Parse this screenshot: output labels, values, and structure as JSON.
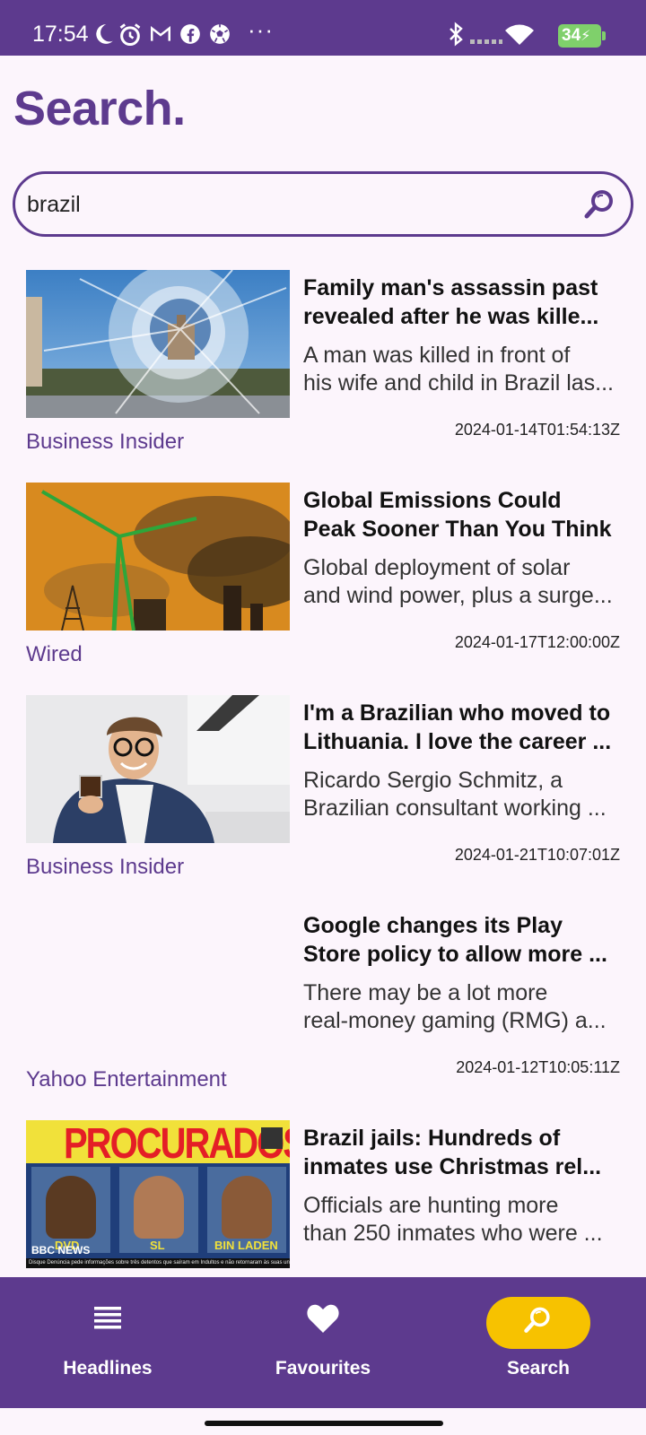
{
  "status_bar": {
    "time": "17:54",
    "battery": "34",
    "icons": [
      "moon-icon",
      "alarm-icon",
      "gmail-icon",
      "facebook-icon",
      "football-icon",
      "more-icon",
      "bluetooth-icon",
      "signal-icon",
      "wifi-icon",
      "battery-icon"
    ]
  },
  "page": {
    "title": "Search."
  },
  "search": {
    "value": "brazil",
    "icon": "search-icon"
  },
  "articles": [
    {
      "headline_lines": [
        "Family man's assassin past",
        "revealed after he was kille..."
      ],
      "description_lines": [
        "A man was killed in front of",
        "his wife and child in Brazil las..."
      ],
      "date": "2024-01-14T01:54:13Z",
      "source": "Business Insider"
    },
    {
      "headline_lines": [
        "Global Emissions Could",
        "Peak Sooner Than You Think"
      ],
      "description_lines": [
        "Global deployment of solar",
        "and wind power, plus a surge..."
      ],
      "date": "2024-01-17T12:00:00Z",
      "source": "Wired"
    },
    {
      "headline_lines": [
        "I'm a Brazilian who moved to",
        "Lithuania. I love the career ..."
      ],
      "description_lines": [
        "Ricardo Sergio Schmitz, a",
        "Brazilian consultant working ..."
      ],
      "date": "2024-01-21T10:07:01Z",
      "source": "Business Insider"
    },
    {
      "headline_lines": [
        "Google changes its Play",
        "Store policy to allow more ..."
      ],
      "description_lines": [
        "There may be a lot more",
        "real-money gaming (RMG) a..."
      ],
      "date": "2024-01-12T10:05:11Z",
      "source": "Yahoo Entertainment"
    },
    {
      "headline_lines": [
        "Brazil jails: Hundreds of",
        "inmates use Christmas rel..."
      ],
      "description_lines": [
        "Officials are hunting more",
        "than 250 inmates who were ..."
      ],
      "image_text": {
        "banner": "PROCURADOS",
        "names": [
          "DVD",
          "SL",
          "BIN LADEN"
        ],
        "logo": "BBC NEWS",
        "caption": "Disque Denúncia pede informações sobre três detentos que saíram em Indultos e não retornaram às suas unidades prisionais"
      }
    }
  ],
  "bottom_nav": {
    "items": [
      {
        "label": "Headlines",
        "icon": "list-icon",
        "active": false
      },
      {
        "label": "Favourites",
        "icon": "heart-icon",
        "active": false
      },
      {
        "label": "Search",
        "icon": "search-icon",
        "active": true
      }
    ],
    "colors": {
      "background": "#5D3A8E",
      "active_pill": "#F7C200"
    }
  },
  "colors": {
    "accent": "#5D3A8E",
    "background": "#FCF5FC"
  }
}
